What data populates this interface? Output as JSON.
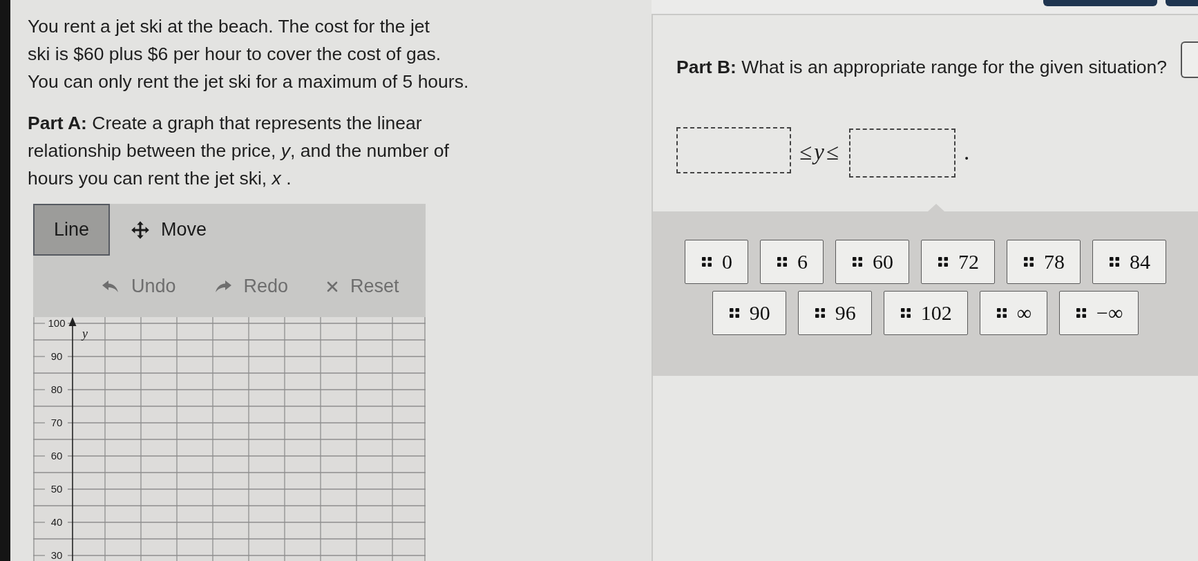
{
  "problem": {
    "intro": "You rent a jet ski at the beach. The cost for the jet\nski is $60 plus $6 per hour to cover the cost of gas.\nYou can only rent the jet ski for a maximum of 5 hours.",
    "part_a": "**Part A:** Create a graph that represents the linear\nrelationship between the price, *y*, and the number of\nhours you can rent the jet ski, *x* ."
  },
  "graph": {
    "tools": [
      {
        "kind": "line",
        "label": "Line",
        "selected": true
      },
      {
        "kind": "move",
        "label": "Move",
        "selected": false
      }
    ],
    "actions": [
      {
        "kind": "undo",
        "label": "Undo",
        "disabled": true
      },
      {
        "kind": "redo",
        "label": "Redo",
        "disabled": true
      },
      {
        "kind": "reset",
        "label": "Reset",
        "disabled": true
      }
    ],
    "y_axis": {
      "label": "y",
      "tick_labels": [
        "100",
        "90",
        "80",
        "70",
        "60",
        "50",
        "40",
        "30"
      ]
    }
  },
  "part_b": {
    "prompt": "**Part B:** What is an appropriate range for the given situation?",
    "answer": [
      {
        "kind": "blank"
      },
      {
        "kind": "text",
        "text": "≤*y*≤"
      },
      {
        "kind": "blank"
      },
      {
        "kind": "text",
        "text": "."
      }
    ],
    "tiles": [
      "0",
      "6",
      "60",
      "72",
      "78",
      "84",
      "90",
      "96",
      "102",
      "∞",
      "−∞"
    ]
  }
}
